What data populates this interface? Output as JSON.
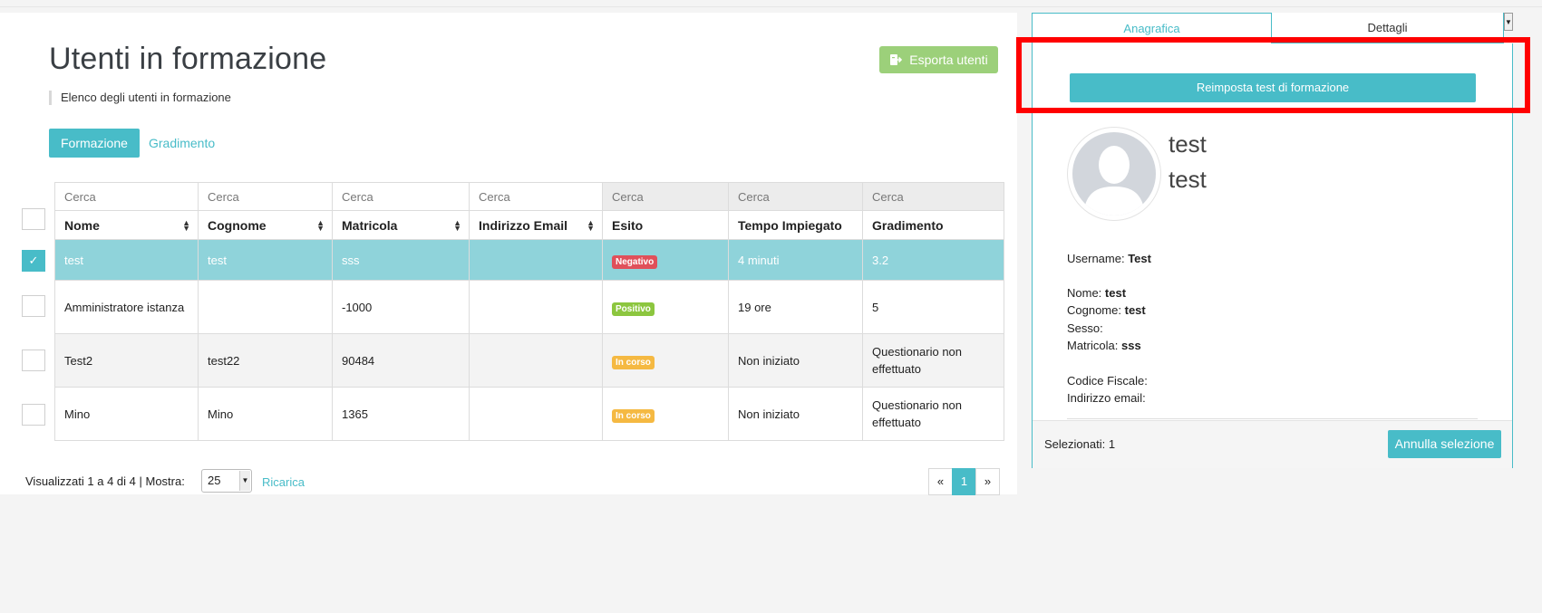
{
  "page": {
    "title": "Utenti in formazione",
    "subtitle": "Elenco degli utenti in formazione",
    "export_label": "Esporta utenti"
  },
  "tabs": {
    "formazione": "Formazione",
    "gradimento": "Gradimento"
  },
  "table": {
    "search_placeholder": "Cerca",
    "columns": [
      "Nome",
      "Cognome",
      "Matricola",
      "Indirizzo Email",
      "Esito",
      "Tempo Impiegato",
      "Gradimento"
    ],
    "rows": [
      {
        "nome": "test",
        "cognome": "test",
        "matricola": "sss",
        "email": "",
        "esito": "Negativo",
        "tempo": "4 minuti",
        "gradimento": "3.2",
        "selected": true
      },
      {
        "nome": "Amministratore istanza",
        "cognome": "",
        "matricola": "-1000",
        "email": "",
        "esito": "Positivo",
        "tempo": "19 ore",
        "gradimento": "5",
        "selected": false
      },
      {
        "nome": "Test2",
        "cognome": "test22",
        "matricola": "90484",
        "email": "",
        "esito": "In corso",
        "tempo": "Non iniziato",
        "gradimento": "Questionario non effettuato",
        "selected": false
      },
      {
        "nome": "Mino",
        "cognome": "Mino",
        "matricola": "1365",
        "email": "",
        "esito": "In corso",
        "tempo": "Non iniziato",
        "gradimento": "Questionario non effettuato",
        "selected": false
      }
    ],
    "check_mark": "✓"
  },
  "colors": {
    "accent": "#48bcc8",
    "negativo": "#e0505a",
    "positivo": "#8cc63f",
    "in_corso": "#f5b942",
    "selected_row": "#8fd3da",
    "export": "#9cd07a",
    "highlight": "#ff0000"
  },
  "footer": {
    "info": "Visualizzati 1 a 4 di 4  |  Mostra:",
    "page_size": "25",
    "reload": "Ricarica",
    "prev": "«",
    "current_page": "1",
    "next": "»"
  },
  "side": {
    "tab_anagrafica": "Anagrafica",
    "tab_dettagli": "Dettagli",
    "reset_label": "Reimposta test di formazione",
    "first_name_big": "test",
    "last_name_big": "test",
    "username_label": "Username:",
    "username": "Test",
    "nome_label": "Nome:",
    "nome": "test",
    "cognome_label": "Cognome:",
    "cognome": "test",
    "sesso_label": "Sesso:",
    "sesso": "",
    "matricola_label": "Matricola:",
    "matricola": "sss",
    "cf_label": "Codice Fiscale:",
    "cf": "",
    "email_label": "Indirizzo email:",
    "email": "",
    "selected_label": "Selezionati: 1",
    "cancel_label": "Annulla selezione"
  }
}
